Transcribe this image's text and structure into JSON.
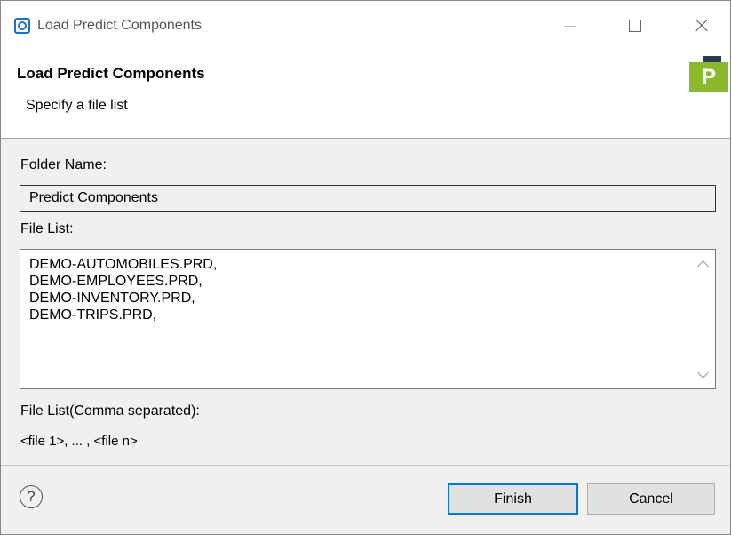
{
  "window": {
    "title": "Load Predict Components"
  },
  "banner": {
    "title": "Load Predict Components",
    "subtitle": "Specify a file list",
    "logo_letter": "P"
  },
  "form": {
    "folder_label": "Folder Name:",
    "folder_value": "Predict Components",
    "filelist_label": "File List:",
    "filelist_lines": [
      "DEMO-AUTOMOBILES.PRD,",
      "DEMO-EMPLOYEES.PRD,",
      "DEMO-INVENTORY.PRD,",
      "DEMO-TRIPS.PRD,"
    ],
    "comma_label": "File List(Comma separated):",
    "pattern_text": "<file 1>, ... , <file n>"
  },
  "footer": {
    "help_symbol": "?",
    "finish_label": "Finish",
    "cancel_label": "Cancel"
  },
  "colors": {
    "accent": "#0078d7",
    "logo_green": "#8bb82c",
    "logo_dark": "#2e3a54"
  }
}
